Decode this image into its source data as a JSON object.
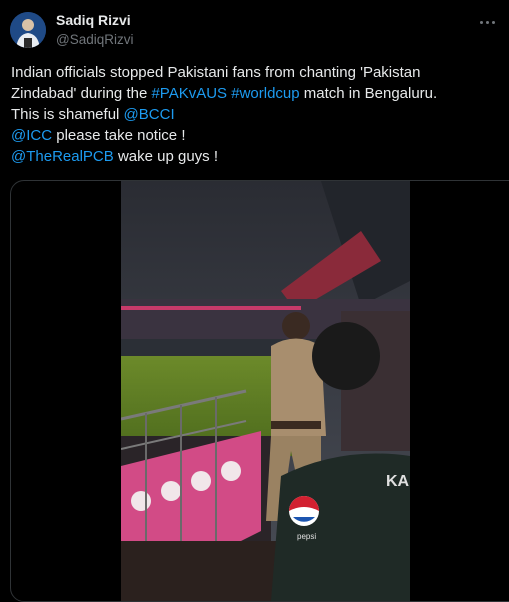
{
  "author": {
    "name": "Sadiq Rizvi",
    "handle": "@SadiqRizvi"
  },
  "tweet": {
    "line1": "Indian officials stopped Pakistani fans from chanting 'Pakistan",
    "line2_a": "Zindabad' during the ",
    "hashtag1": "#PAKvAUS",
    "hashtag2": "#worldcup",
    "line2_b": " match in Bengaluru.",
    "line3_a": "This is shameful ",
    "mention1": "@BCCI",
    "mention2": "@ICC",
    "line4_b": " please take notice !",
    "mention3": "@TheRealPCB",
    "line5_b": " wake up guys !"
  },
  "media": {
    "jersey_text": "KA",
    "jersey_brand": "pepsi"
  },
  "colors": {
    "link": "#1d9bf0",
    "text": "#e7e9ea",
    "muted": "#71767b"
  },
  "icons": [
    "avatar-image",
    "more-options-icon"
  ]
}
